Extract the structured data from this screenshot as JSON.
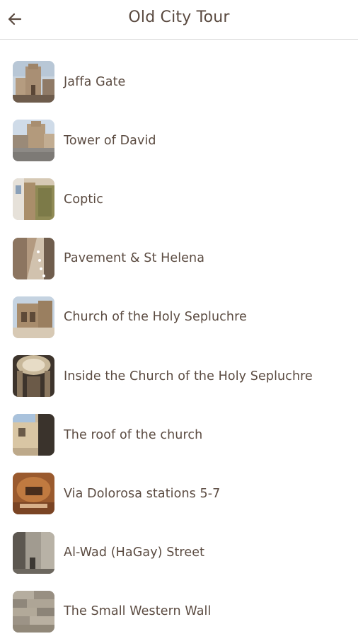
{
  "header": {
    "title": "Old City Tour",
    "back_icon": "arrow-left-icon"
  },
  "stops": [
    {
      "label": "Jaffa Gate",
      "icon": "jaffa-gate-thumbnail"
    },
    {
      "label": "Tower of David",
      "icon": "tower-of-david-thumbnail"
    },
    {
      "label": "Coptic",
      "icon": "coptic-thumbnail"
    },
    {
      "label": "Pavement & St Helena",
      "icon": "pavement-st-helena-thumbnail"
    },
    {
      "label": "Church of the Holy Sepluchre",
      "icon": "church-holy-sepulchre-thumbnail"
    },
    {
      "label": "Inside the Church of the Holy Sepluchre",
      "icon": "inside-church-thumbnail"
    },
    {
      "label": "The roof of the church",
      "icon": "roof-of-church-thumbnail"
    },
    {
      "label": "Via Dolorosa stations 5-7",
      "icon": "via-dolorosa-thumbnail"
    },
    {
      "label": "Al-Wad (HaGay) Street",
      "icon": "al-wad-street-thumbnail"
    },
    {
      "label": "The Small Western Wall",
      "icon": "small-western-wall-thumbnail"
    }
  ]
}
